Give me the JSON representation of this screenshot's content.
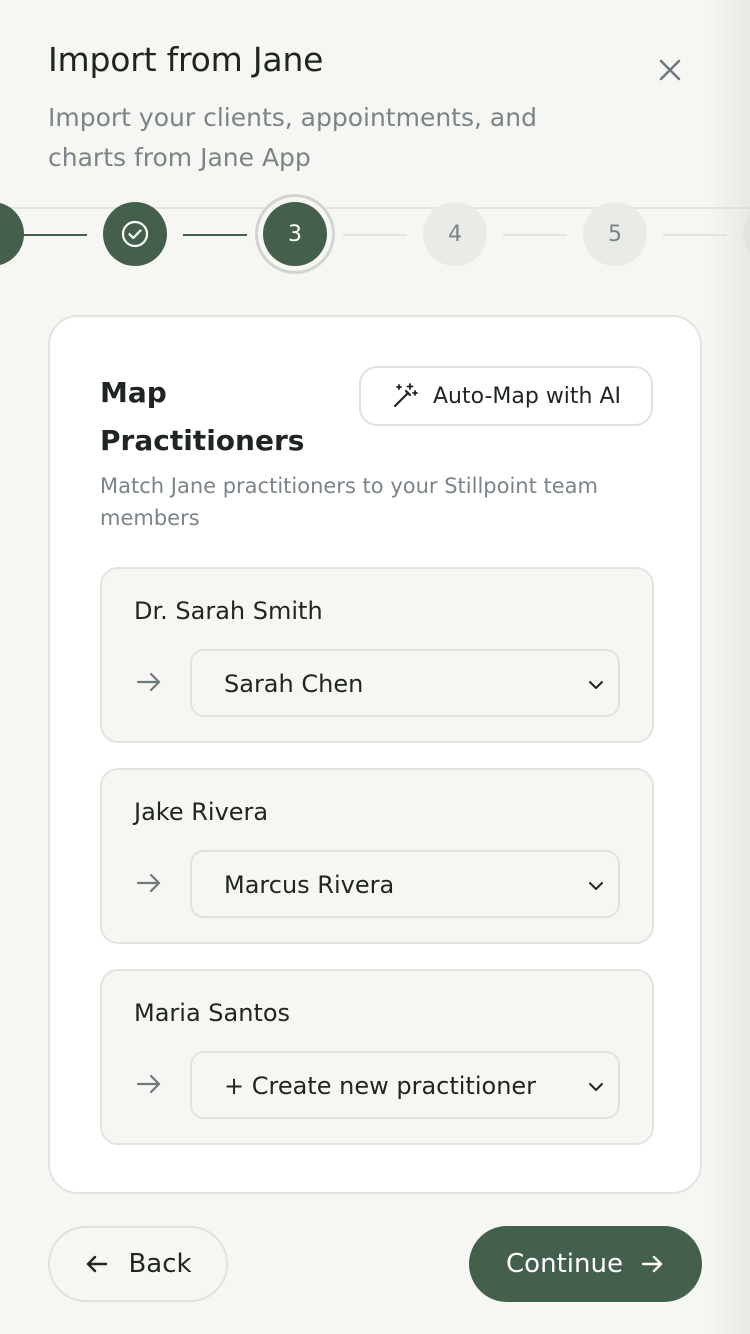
{
  "header": {
    "title": "Import from Jane",
    "subtitle": "Import your clients, appointments, and charts from Jane App",
    "close_icon": "close-icon"
  },
  "stepper": {
    "steps": [
      {
        "label": "",
        "state": "done",
        "icon": "check-icon"
      },
      {
        "label": "",
        "state": "done",
        "icon": "check-circle-icon"
      },
      {
        "label": "3",
        "state": "active"
      },
      {
        "label": "4",
        "state": "todo"
      },
      {
        "label": "5",
        "state": "todo"
      },
      {
        "label": "",
        "state": "todo"
      }
    ],
    "current_step": 3
  },
  "card": {
    "title": "Map Practitioners",
    "automap_label": "Auto-Map with AI",
    "automap_icon": "magic-wand-icon",
    "description": "Match Jane practitioners to your Stillpoint team members",
    "mappings": [
      {
        "jane_name": "Dr. Sarah Smith",
        "selected": "Sarah Chen"
      },
      {
        "jane_name": "Jake Rivera",
        "selected": "Marcus Rivera"
      },
      {
        "jane_name": "Maria Santos",
        "selected": "+ Create new practitioner"
      }
    ]
  },
  "footer": {
    "back_label": "Back",
    "continue_label": "Continue"
  },
  "colors": {
    "primary": "#44604d",
    "background": "#f6f6f3",
    "card": "#ffffff",
    "muted_text": "#7a8489",
    "border": "#e3e3df"
  }
}
